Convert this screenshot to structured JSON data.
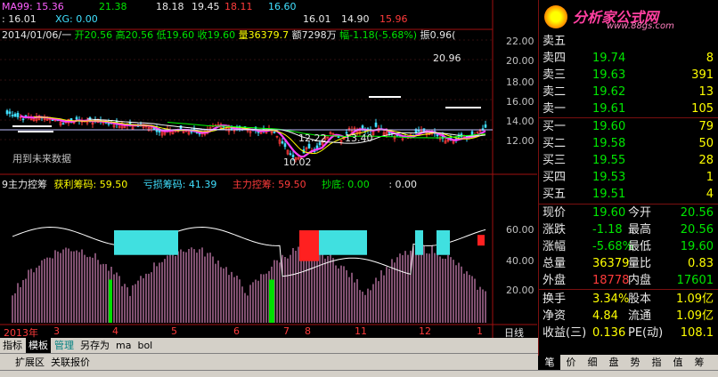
{
  "header": {
    "row0": [
      {
        "text": "21.38",
        "cls": "dn"
      },
      {
        "text": "18.18",
        "cls": "wh"
      },
      {
        "text": "19.45",
        "cls": "wh"
      },
      {
        "text": "18.11",
        "cls": "up"
      },
      {
        "text": "16.60",
        "cls": "cy"
      }
    ],
    "ma99": "MA99: 15.36",
    "xg": "XG: 0.00",
    "row1_left": ": 16.01",
    "row1_right": [
      {
        "text": "16.01",
        "cls": "wh"
      },
      {
        "text": "14.90",
        "cls": "wh"
      },
      {
        "text": "15.96",
        "cls": "up"
      }
    ],
    "quote_date": "2014/01/06/一",
    "quote_open": "开20.56",
    "quote_high": "高20.56",
    "quote_low": "低19.60",
    "quote_close": "收19.60",
    "quote_vol": "量36379.7",
    "quote_amt": "额7298万",
    "quote_chg": "幅-1.18(-5.68%)",
    "quote_amp": "振0.96("
  },
  "price_axis": [
    "22.00",
    "20.00",
    "18.00",
    "16.00",
    "14.00",
    "12.00"
  ],
  "annotations": {
    "high_label": "20.96",
    "low_label": "10.02",
    "mid_label1": "12.22",
    "mid_label2": "13.40",
    "future_note": "用到未来数据"
  },
  "indicator": {
    "name": "9主力控筹",
    "profit_label": "获利筹码: 59.50",
    "loss_label": "亏损筹码: 41.39",
    "control_label": "主力控筹: 59.50",
    "bottom_label": "抄底: 0.00",
    "extra": ": 0.00",
    "axis": [
      "60.00",
      "40.00",
      "20.00"
    ]
  },
  "time_axis": [
    "2013年",
    "3",
    "4",
    "5",
    "6",
    "7",
    "8",
    "11",
    "12",
    "1"
  ],
  "period": "日线",
  "tabs1": [
    {
      "label": "指标",
      "cls": ""
    },
    {
      "label": "模板",
      "cls": "active"
    },
    {
      "label": "管理",
      "cls": "cyan"
    },
    {
      "label": "另存为",
      "cls": ""
    },
    {
      "label": "ma",
      "cls": ""
    },
    {
      "label": "bol",
      "cls": ""
    }
  ],
  "tabs2": [
    {
      "label": "扩展区"
    },
    {
      "label": "关联报价"
    }
  ],
  "panel": {
    "logo_text": "分析家公式网",
    "logo_url": "www.88gs.com",
    "asks": [
      {
        "label": "卖五",
        "price": "",
        "vol": ""
      },
      {
        "label": "卖四",
        "price": "19.74",
        "vol": "8"
      },
      {
        "label": "卖三",
        "price": "19.63",
        "vol": "391"
      },
      {
        "label": "卖二",
        "price": "19.62",
        "vol": "13"
      },
      {
        "label": "卖一",
        "price": "19.61",
        "vol": "105"
      }
    ],
    "bids": [
      {
        "label": "买一",
        "price": "19.60",
        "vol": "79"
      },
      {
        "label": "买二",
        "price": "19.58",
        "vol": "50"
      },
      {
        "label": "买三",
        "price": "19.55",
        "vol": "28"
      },
      {
        "label": "买四",
        "price": "19.53",
        "vol": "1"
      },
      {
        "label": "买五",
        "price": "19.51",
        "vol": "4"
      }
    ],
    "stats": [
      {
        "l1": "现价",
        "v1": "19.60",
        "c1": "dn",
        "l2": "今开",
        "v2": "20.56",
        "c2": "dn"
      },
      {
        "l1": "涨跌",
        "v1": "-1.18",
        "c1": "dn",
        "l2": "最高",
        "v2": "20.56",
        "c2": "dn"
      },
      {
        "l1": "涨幅",
        "v1": "-5.68%",
        "c1": "dn",
        "l2": "最低",
        "v2": "19.60",
        "c2": "dn"
      },
      {
        "l1": "总量",
        "v1": "36379",
        "c1": "yl",
        "l2": "量比",
        "v2": "0.83",
        "c2": "yl"
      },
      {
        "l1": "外盘",
        "v1": "18778",
        "c1": "up",
        "l2": "内盘",
        "v2": "17601",
        "c2": "dn"
      }
    ],
    "stats2": [
      {
        "l1": "换手",
        "v1": "3.34%",
        "l2": "股本",
        "v2": "1.09亿"
      },
      {
        "l1": "净资",
        "v1": "4.84",
        "l2": "流通",
        "v2": "1.09亿"
      },
      {
        "l1": "收益(三)",
        "v1": "0.136",
        "l2": "PE(动)",
        "v2": "108.1"
      }
    ],
    "bottom_tabs": [
      "笔",
      "价",
      "细",
      "盘",
      "势",
      "指",
      "值",
      "筹"
    ]
  }
}
